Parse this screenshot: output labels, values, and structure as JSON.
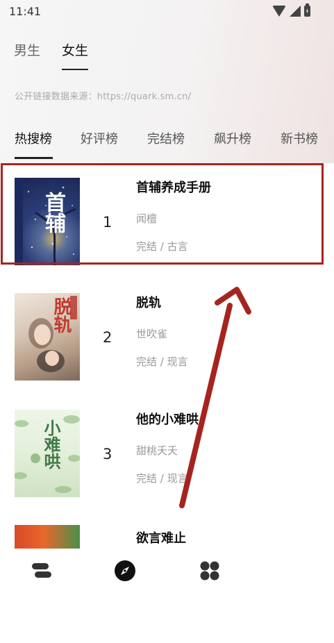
{
  "status_bar": {
    "time": "11:41"
  },
  "gender_tabs": [
    {
      "label": "男生",
      "active": false
    },
    {
      "label": "女生",
      "active": true
    }
  ],
  "source_note": "公开链接数据来源：https://quark.sm.cn/",
  "rank_tabs": [
    {
      "label": "热搜榜",
      "active": true
    },
    {
      "label": "好评榜",
      "active": false
    },
    {
      "label": "完结榜",
      "active": false
    },
    {
      "label": "飙升榜",
      "active": false
    },
    {
      "label": "新书榜",
      "active": false
    }
  ],
  "books": [
    {
      "rank": "1",
      "title": "首辅养成手册",
      "author": "闻檀",
      "meta": "完结 / 古言",
      "cover_text": "首辅"
    },
    {
      "rank": "2",
      "title": "脱轨",
      "author": "世吹雀",
      "meta": "完结 / 现言",
      "cover_text": "脱轨"
    },
    {
      "rank": "3",
      "title": "他的小难哄",
      "author": "甜桃夭夭",
      "meta": "完结 / 现言",
      "cover_text": "小难哄"
    },
    {
      "rank": "",
      "title": "欲言难止",
      "author": "",
      "meta": "",
      "cover_text": ""
    }
  ],
  "bottom_nav": [
    {
      "icon": "bookshelf-icon"
    },
    {
      "icon": "compass-icon"
    },
    {
      "icon": "grid-icon"
    }
  ],
  "colors": {
    "highlight": "#a6241f",
    "arrow": "#a6241f"
  }
}
